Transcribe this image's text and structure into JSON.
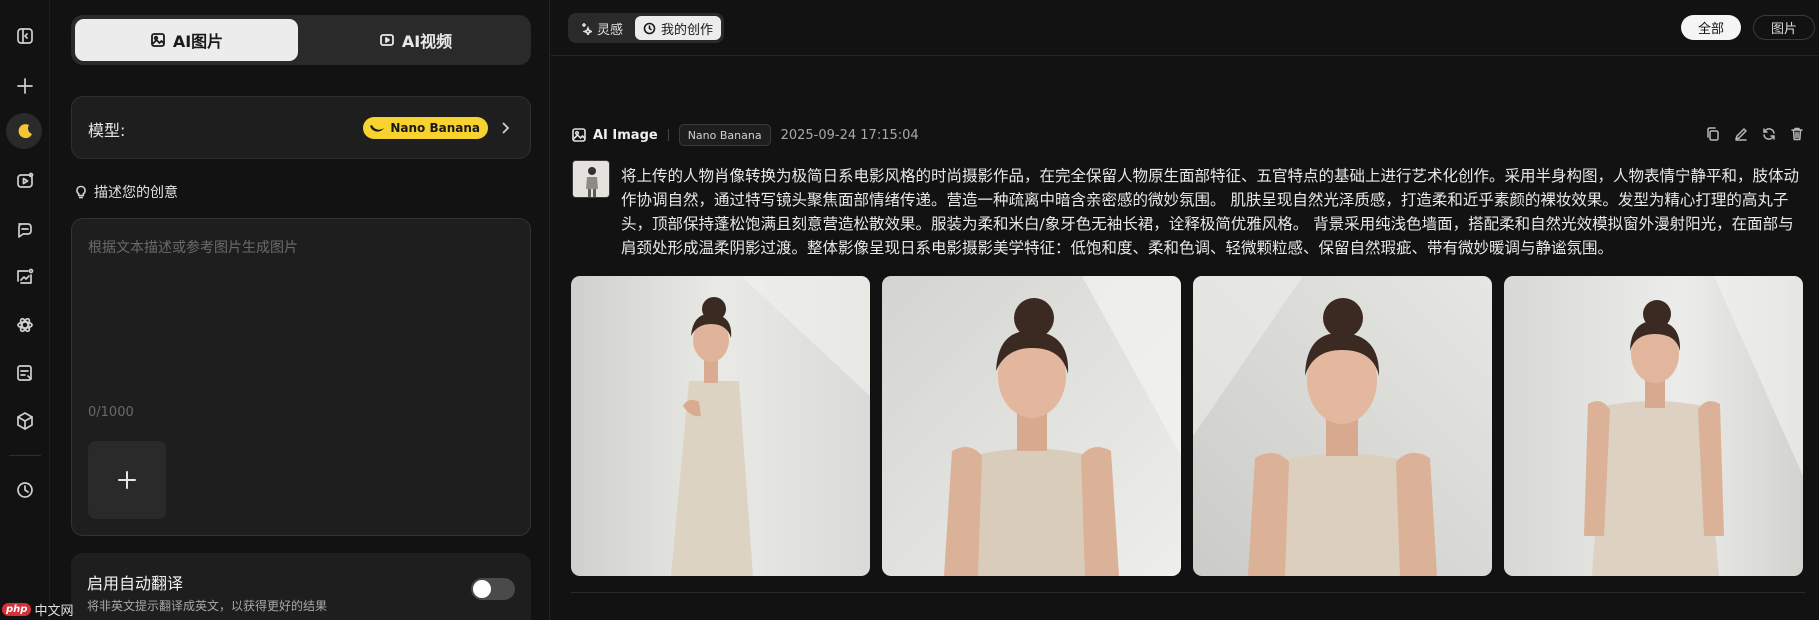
{
  "rail": {
    "items": [
      "sidebar-toggle-icon",
      "new-icon",
      "moon-icon",
      "video-icon",
      "chat-icon",
      "image-edit-icon",
      "atom-icon",
      "document-icon",
      "cube-icon",
      "history-icon"
    ]
  },
  "panel": {
    "mode_tabs": [
      {
        "label": "AI图片",
        "icon": "image-icon",
        "active": true
      },
      {
        "label": "AI视频",
        "icon": "video-icon",
        "active": false
      }
    ],
    "model": {
      "label": "模型:",
      "value": "Nano Banana",
      "accent": "#f8d22e"
    },
    "description_heading": "描述您的创意",
    "prompt": {
      "placeholder": "根据文本描述或参考图片生成图片",
      "value": "",
      "counter": "0/1000"
    },
    "auto_translate": {
      "title": "启用自动翻译",
      "subtitle": "将非英文提示翻译成英文，以获得更好的结果",
      "enabled": false
    },
    "watermark": {
      "badge": "php",
      "text": "中文网"
    }
  },
  "main": {
    "tabs": [
      {
        "label": "灵感",
        "icon": "sparkle-icon",
        "active": false
      },
      {
        "label": "我的创作",
        "icon": "clock-icon",
        "active": true
      }
    ],
    "filters": [
      {
        "label": "全部",
        "active": true
      },
      {
        "label": "图片",
        "active": false
      }
    ],
    "entry": {
      "type_label": "AI Image",
      "model_chip": "Nano Banana",
      "timestamp": "2025-09-24 17:15:04",
      "actions": [
        "copy-icon",
        "edit-icon",
        "refresh-icon",
        "trash-icon"
      ],
      "prompt": "将上传的人物肖像转换为极简日系电影风格的时尚摄影作品，在完全保留人物原生面部特征、五官特点的基础上进行艺术化创作。采用半身构图，人物表情宁静平和，肢体动作协调自然，通过特写镜头聚焦面部情绪传递。营造一种疏离中暗含亲密感的微妙氛围。 肌肤呈现自然光泽质感，打造柔和近乎素颜的裸妆效果。发型为精心打理的高丸子头，顶部保持蓬松饱满且刻意营造松散效果。服装为柔和米白/象牙色无袖长裙，诠释极简优雅风格。 背景采用纯浅色墙面，搭配柔和自然光效模拟窗外漫射阳光，在面部与肩颈处形成温柔阴影过渡。整体影像呈现日系电影摄影美学特征：低饱和度、柔和色调、轻微颗粒感、保留自然瑕疵、带有微妙暖调与静谧氛围。",
      "image_count": 4
    }
  }
}
